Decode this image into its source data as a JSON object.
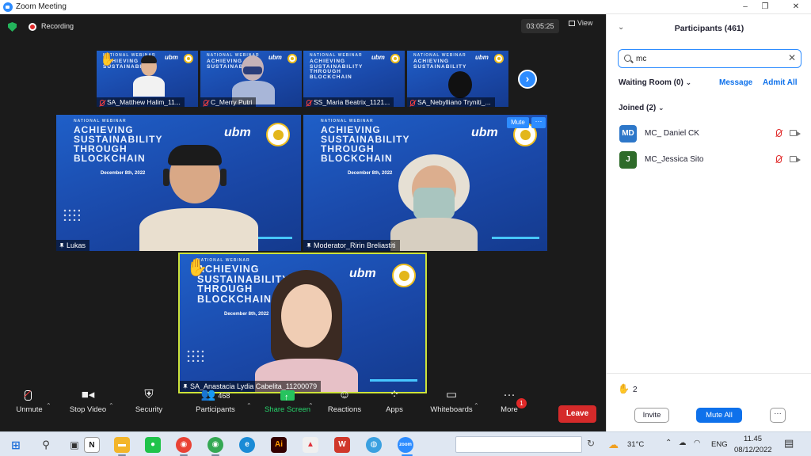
{
  "window": {
    "title": "Zoom Meeting",
    "controls": [
      "–",
      "❐",
      "✕"
    ]
  },
  "meeting": {
    "recording_label": "Recording",
    "timer": "03:05:25",
    "view_label": "View",
    "tile_banner": {
      "series": "NATIONAL WEBINAR",
      "title_lines": [
        "ACHIEVING",
        "SUSTAINABILITY",
        "THROUGH",
        "BLOCKCHAIN"
      ],
      "date": "December 8th, 2022",
      "logo": "ubm"
    },
    "thumbnails": [
      {
        "name": "SA_Matthew Halim_11...",
        "hand": true
      },
      {
        "name": "C_Merry Putri",
        "hand": false
      },
      {
        "name": "SS_Maria Beatrix_1121...",
        "hand": false
      },
      {
        "name": "SA_Nebylliano Tryniti_...",
        "hand": false
      }
    ],
    "main_tiles": [
      {
        "name": "Lukas"
      },
      {
        "name": "Moderator_Ririn Breliastiti",
        "mute_label": "Mute",
        "more_label": "···"
      }
    ],
    "active_tile": {
      "name": "SA_Anastacia Lydia Cabelita_11200079"
    }
  },
  "toolbar": {
    "unmute": "Unmute",
    "stop_video": "Stop Video",
    "security": "Security",
    "participants": "Participants",
    "participants_count": "468",
    "share_screen": "Share Screen",
    "reactions": "Reactions",
    "apps": "Apps",
    "whiteboards": "Whiteboards",
    "more": "More",
    "more_badge": "1",
    "leave": "Leave"
  },
  "panel": {
    "title": "Participants (461)",
    "search_value": "mc",
    "waiting_room": "Waiting Room (0)",
    "message": "Message",
    "admit_all": "Admit All",
    "joined": "Joined (2)",
    "participants": [
      {
        "initials": "MD",
        "name": "MC_ Daniel CK",
        "color": "#2d77c9"
      },
      {
        "initials": "J",
        "name": "MC_Jessica Sito",
        "color": "#2e6b2a"
      }
    ],
    "raised_hands": "2",
    "invite": "Invite",
    "mute_all": "Mute All",
    "more": "···"
  },
  "taskbar": {
    "temperature": "31°C",
    "language": "ENG",
    "time": "11.45",
    "date": "08/12/2022"
  }
}
